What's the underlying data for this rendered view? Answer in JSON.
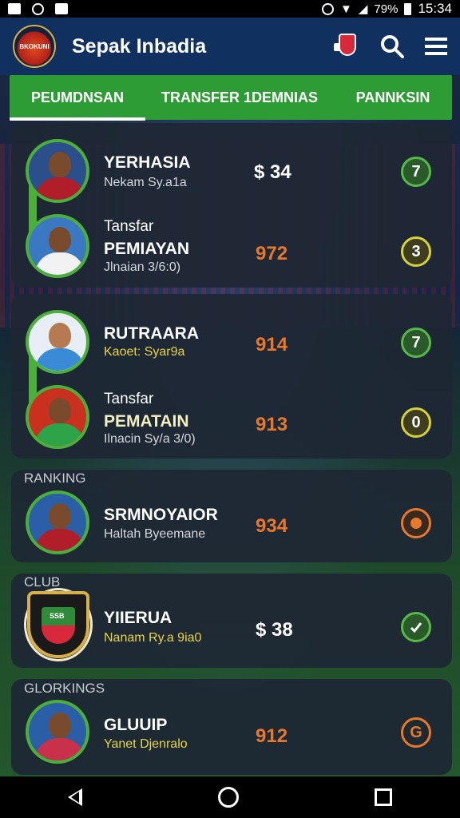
{
  "status_bar": {
    "battery": "79%",
    "time": "15:34"
  },
  "app": {
    "title": "Sepak Inbadia",
    "logo_text": "BKOKUNI"
  },
  "icons": {
    "search": "search-icon",
    "menu": "menu-icon",
    "badge": "team-badge-icon"
  },
  "tabs": [
    {
      "label": "PEUMDNSAN",
      "active": true
    },
    {
      "label": "TRANSFER 1DEMNIAS",
      "active": false
    },
    {
      "label": "PANNKSIN",
      "active": false
    }
  ],
  "cards": {
    "card1": {
      "player1": {
        "name": "YERHASIA",
        "sub": "Nekam Sy.a1a",
        "price": "$ 34",
        "rank": "7"
      },
      "player2": {
        "top": "Tansfar",
        "name": "PEMIAYAN",
        "sub": "Jlnaian 3/6:0)",
        "price": "972",
        "rank": "3"
      }
    },
    "card2": {
      "player1": {
        "name": "RUTRAARA",
        "sub": "Kaoet: Syar9a",
        "price": "914",
        "rank": "7"
      },
      "player2": {
        "top": "Tansfar",
        "name": "PEMATAIN",
        "sub": "Ilnacin Sy/a 3/0)",
        "price": "913",
        "rank": "0"
      }
    },
    "card3": {
      "section": "RANKING",
      "name": "SRMNOYAIOR",
      "sub": "Haltah Byeemane",
      "price": "934"
    },
    "card4": {
      "section": "CLUB",
      "crest_text": "SSB",
      "name": "YIIERUA",
      "sub": "Nanam Ry.a 9ia0",
      "price": "$ 38"
    },
    "card5": {
      "section": "GLORKINGS",
      "name": "GLUUIP",
      "sub": "Yanet Djenralo",
      "price": "912",
      "rank": "G"
    }
  },
  "colors": {
    "tab_bar": "#2e9c35",
    "app_bar": "#10315f",
    "card_bg": "#1e2734",
    "price_orange": "#e8782a",
    "rank_green": "#56b948",
    "rank_yellow": "#d8d23a"
  }
}
